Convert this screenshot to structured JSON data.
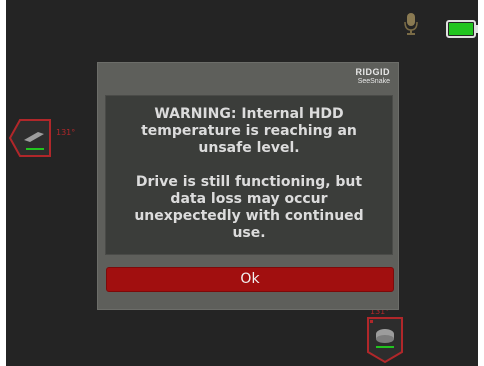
{
  "brand": {
    "line1": "RIDGID",
    "line2": "SeeSnake"
  },
  "dialog": {
    "warning_text": "WARNING: Internal HDD temperature is reaching an unsafe level.",
    "detail_text": "Drive is still functioning, but data loss may occur unexpectedly with continued use.",
    "ok_label": "Ok"
  },
  "status": {
    "left_badge_label": "131°",
    "bottom_badge_label": "131°"
  },
  "colors": {
    "battery": "#22c41f",
    "ok_button": "#a10f0f",
    "badge": "#b0272a"
  },
  "icons": {
    "mic": "microphone-icon",
    "battery": "battery-icon",
    "camera_left": "camera-head-icon",
    "camera_bottom": "camera-head-icon"
  }
}
